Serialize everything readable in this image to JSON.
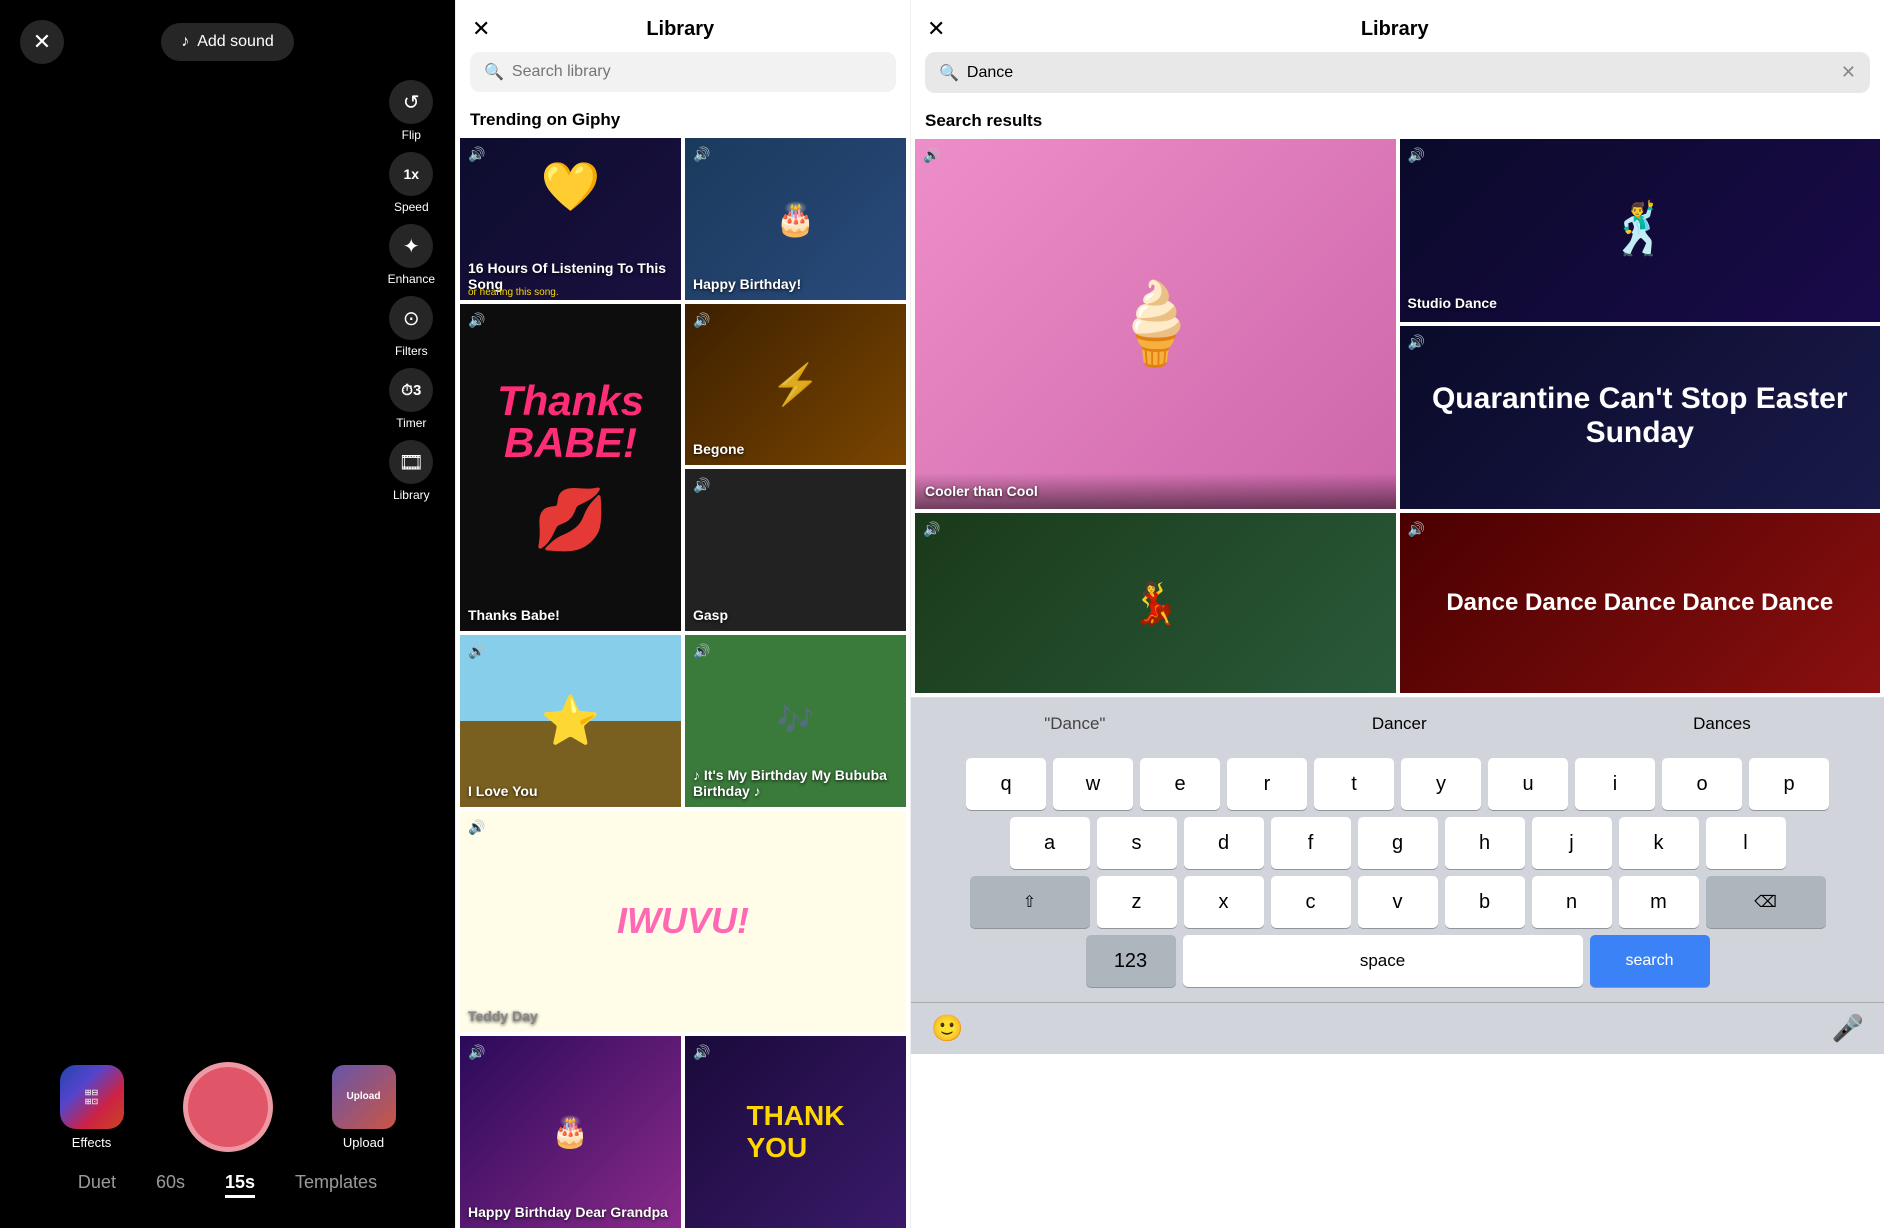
{
  "left": {
    "add_sound": "Add sound",
    "tools": [
      {
        "id": "flip",
        "label": "Flip",
        "icon": "↺"
      },
      {
        "id": "speed",
        "label": "Speed",
        "icon": "⏩"
      },
      {
        "id": "enhance",
        "label": "Enhance",
        "icon": "✨"
      },
      {
        "id": "filters",
        "label": "Filters",
        "icon": "⊙"
      },
      {
        "id": "timer",
        "label": "Timer",
        "icon": "⏱"
      },
      {
        "id": "library",
        "label": "Library",
        "icon": "🎞"
      }
    ],
    "bottom_icons": [
      {
        "id": "effects",
        "label": "Effects"
      },
      {
        "id": "upload",
        "label": "Upload"
      }
    ],
    "tabs": [
      {
        "id": "duet",
        "label": "Duet",
        "active": false
      },
      {
        "id": "60s",
        "label": "60s",
        "active": false
      },
      {
        "id": "15s",
        "label": "15s",
        "active": true
      },
      {
        "id": "templates",
        "label": "Templates",
        "active": false
      }
    ]
  },
  "middle": {
    "title": "Library",
    "search_placeholder": "Search library",
    "section_label": "Trending on Giphy",
    "gifs": [
      {
        "id": "16hours",
        "label": "16 Hours Of Listening To This Song",
        "sublabel": "or hearing this song.",
        "has_sound": true
      },
      {
        "id": "birthday",
        "label": "Happy Birthday!",
        "has_sound": true
      },
      {
        "id": "thanks",
        "label": "Thanks Babe!",
        "has_sound": true
      },
      {
        "id": "begone",
        "label": "Begone",
        "has_sound": true
      },
      {
        "id": "patrick",
        "label": "I Love You",
        "has_sound": true
      },
      {
        "id": "southpark",
        "label": "♪ It's My Birthday My Bububa Birthday ♪",
        "has_sound": true
      },
      {
        "id": "teddy",
        "label": "Teddy Day",
        "has_sound": true
      },
      {
        "id": "grandpa",
        "label": "Happy Birthday Dear Grandpa",
        "has_sound": true
      },
      {
        "id": "gasp",
        "label": "Gasp",
        "has_sound": true
      },
      {
        "id": "thankyou",
        "label": "Thank You",
        "has_sound": true
      }
    ]
  },
  "right": {
    "title": "Library",
    "search_value": "Dance",
    "section_label": "Search results",
    "gifs": [
      {
        "id": "cooler",
        "label": "Cooler than Cool",
        "has_sound": true
      },
      {
        "id": "studio",
        "label": "Studio Dance",
        "has_sound": true
      },
      {
        "id": "kids-dance",
        "label": "",
        "has_sound": true
      },
      {
        "id": "quar",
        "label": "Quarantine Can't Stop Easter Sunday",
        "has_sound": true
      },
      {
        "id": "dance-dance",
        "label": "Dance Dance Dance Dance Dance",
        "has_sound": true
      },
      {
        "id": "dancers2",
        "label": "",
        "has_sound": true
      }
    ],
    "keyboard": {
      "suggestions": [
        "\"Dance\"",
        "Dancer",
        "Dances"
      ],
      "rows": [
        [
          "q",
          "w",
          "e",
          "r",
          "t",
          "y",
          "u",
          "i",
          "o",
          "p"
        ],
        [
          "a",
          "s",
          "d",
          "f",
          "g",
          "h",
          "j",
          "k",
          "l"
        ],
        [
          "z",
          "x",
          "c",
          "v",
          "b",
          "n",
          "m"
        ]
      ],
      "special": {
        "shift": "⇧",
        "backspace": "⌫",
        "numbers": "123",
        "space": "space",
        "search": "search"
      }
    }
  }
}
